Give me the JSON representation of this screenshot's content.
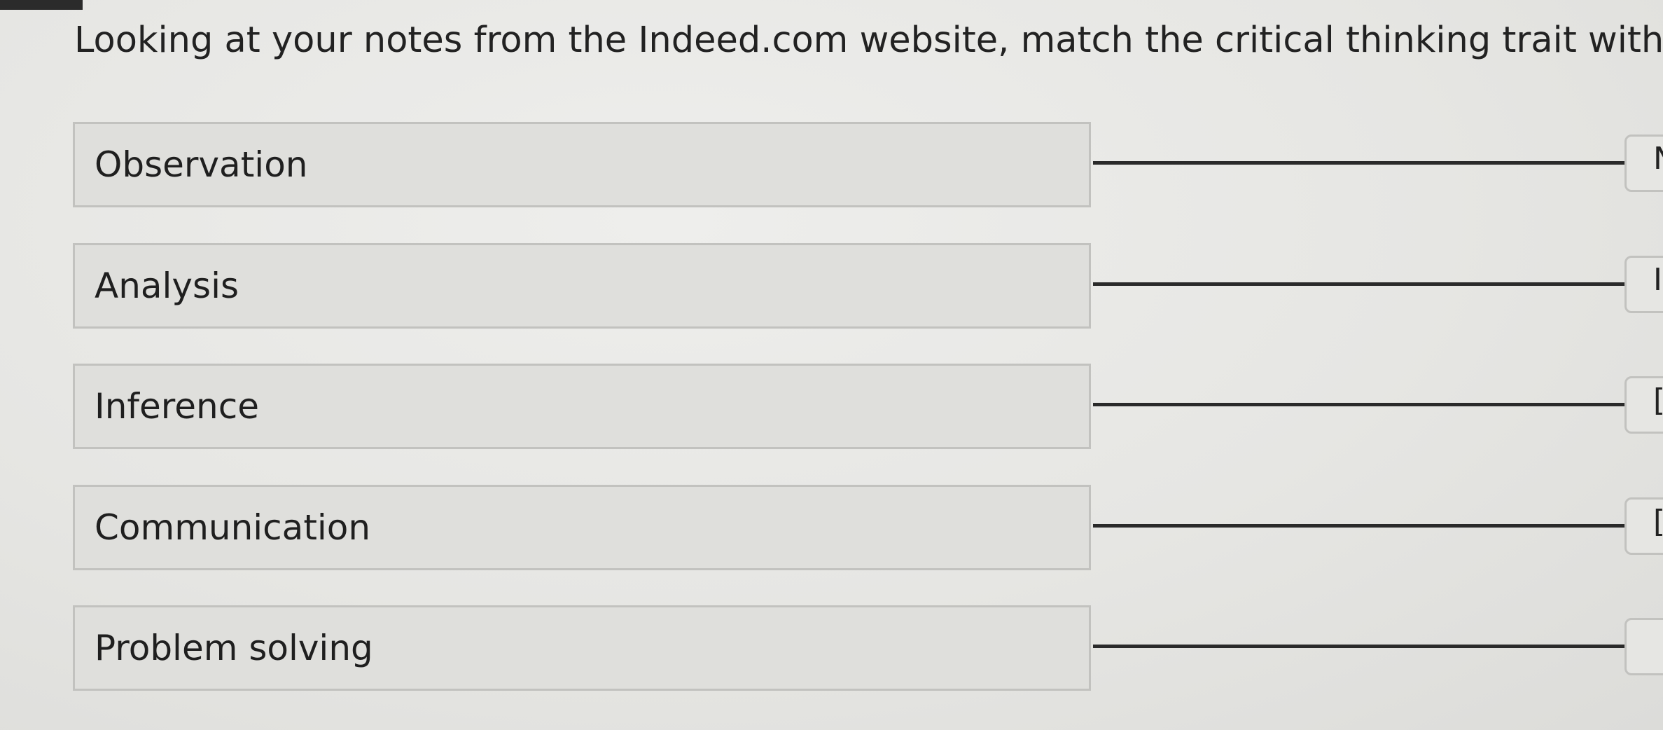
{
  "prompt": "Looking at your notes from the Indeed.com website, match the critical thinking trait with its definition.",
  "terms": [
    {
      "label": "Observation",
      "definition_glyph": "N"
    },
    {
      "label": "Analysis",
      "definition_glyph": "I"
    },
    {
      "label": "Inference",
      "definition_glyph": "["
    },
    {
      "label": "Communication",
      "definition_glyph": "["
    },
    {
      "label": "Problem solving",
      "definition_glyph": ""
    }
  ]
}
